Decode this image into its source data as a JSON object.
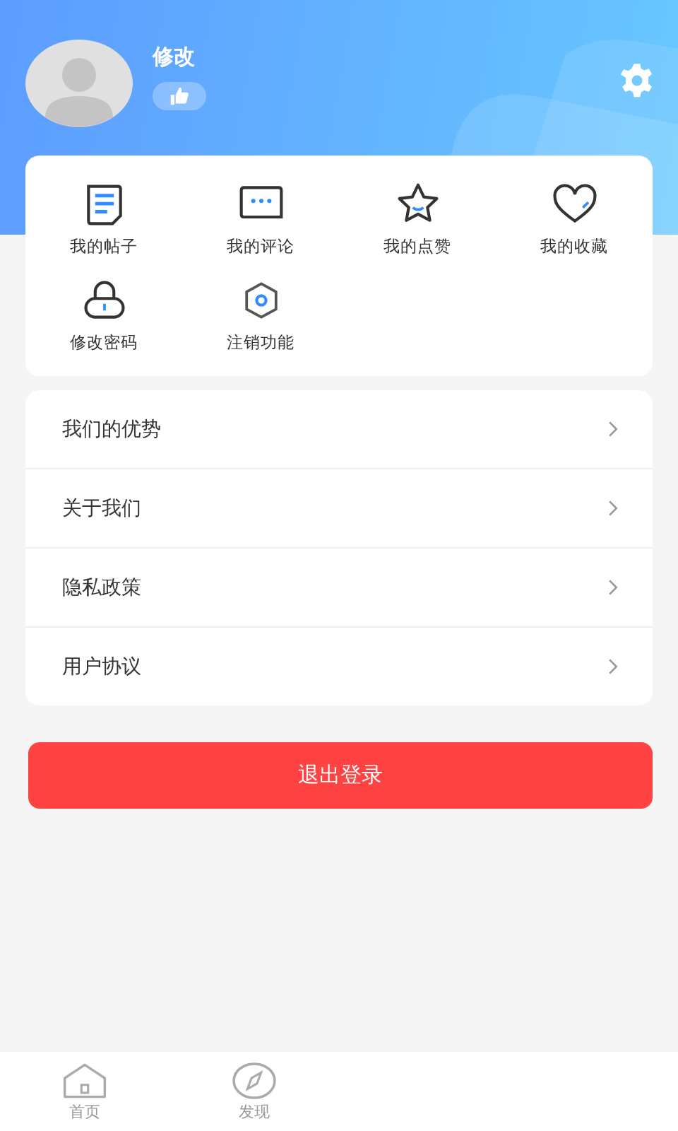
{
  "profile": {
    "name": "修改"
  },
  "shortcuts": [
    {
      "label": "我的帖子",
      "kind": "posts"
    },
    {
      "label": "我的评论",
      "kind": "comments"
    },
    {
      "label": "我的点赞",
      "kind": "likes"
    },
    {
      "label": "我的收藏",
      "kind": "favorites"
    },
    {
      "label": "修改密码",
      "kind": "password"
    },
    {
      "label": "注销功能",
      "kind": "cancel"
    }
  ],
  "menu": [
    "我们的优势",
    "关于我们",
    "隐私政策",
    "用户协议"
  ],
  "logout_button": "退出登录",
  "tab_bar": [
    {
      "label": "首页",
      "kind": "home"
    },
    {
      "label": "发现",
      "kind": "discover"
    }
  ]
}
